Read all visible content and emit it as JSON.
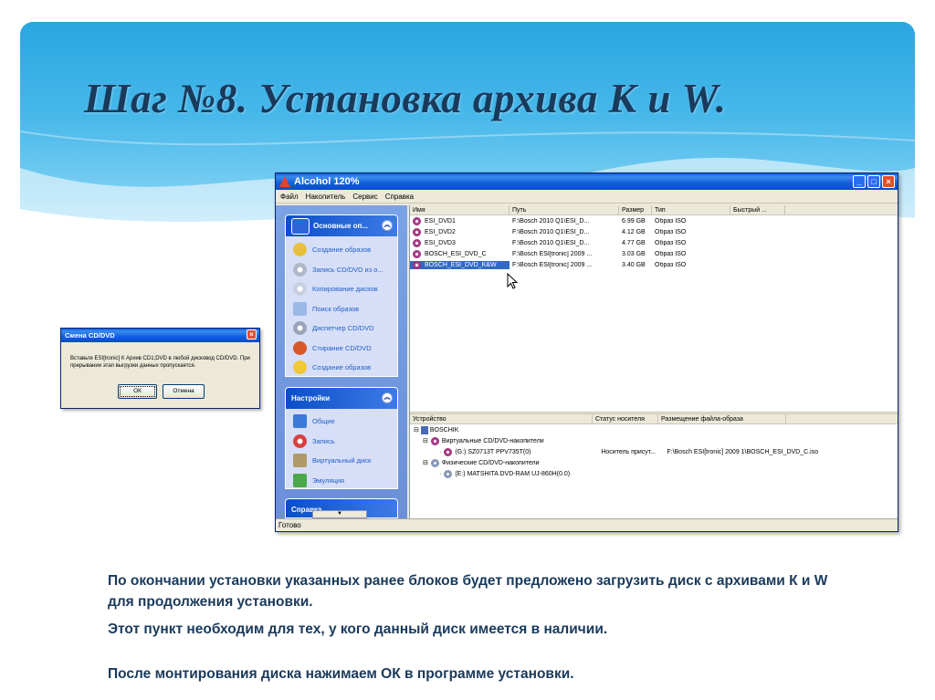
{
  "slide": {
    "title": "Шаг №8. Установка архива К и W.",
    "paragraphs": [
      "По окончании установки  указанных ранее блоков будет предложено загрузить диск с архивами К и W  для продолжения установки.",
      "Этот пункт необходим для тех, у кого данный диск имеется в наличии.",
      "После монтирования диска нажимаем ОК в программе установки."
    ]
  },
  "app": {
    "title": "Alcohol 120%",
    "menu": [
      "Файл",
      "Накопитель",
      "Сервис",
      "Справка"
    ],
    "status": "Готово",
    "panels": [
      {
        "title": "Основные оп...",
        "items": [
          "Создание образов",
          "Запись CD/DVD из о...",
          "Копирование дисков",
          "Поиск образов",
          "Диспетчер CD/DVD",
          "Стирание CD/DVD",
          "Создание образов"
        ]
      },
      {
        "title": "Настройки",
        "items": [
          "Общие",
          "Запись",
          "Виртуальный диск",
          "Эмуляция"
        ]
      },
      {
        "title": "Справка",
        "items": []
      }
    ],
    "file_columns": [
      "Имя",
      "Путь",
      "Размер",
      "Тип",
      "Быстрый ..."
    ],
    "files": [
      {
        "name": "ESI_DVD1",
        "path": "F:\\Bosch 2010 Q1\\ESI_D...",
        "size": "6.99 GB",
        "type": "Образ ISO"
      },
      {
        "name": "ESI_DVD2",
        "path": "F:\\Bosch 2010 Q1\\ESI_D...",
        "size": "4.12 GB",
        "type": "Образ ISO"
      },
      {
        "name": "ESI_DVD3",
        "path": "F:\\Bosch 2010 Q1\\ESI_D...",
        "size": "4.77 GB",
        "type": "Образ ISO"
      },
      {
        "name": "BOSCH_ESI_DVD_C",
        "path": "F:\\Bosch ESI[tronic] 2009 ...",
        "size": "3.03 GB",
        "type": "Образ ISO"
      },
      {
        "name": "BOSCH_ESI_DVD_K&W",
        "path": "F:\\Bosch ESI[tronic] 2009 ...",
        "size": "3.40 GB",
        "type": "Образ ISO"
      }
    ],
    "selected_file_index": 4,
    "device_columns": [
      "Устройство",
      "Статус носителя",
      "Размещение файла-образа"
    ],
    "devices": {
      "root": "BOSCHIK",
      "virtual_group": "Виртуальные CD/DVD-накопители",
      "virtual_drive": "(G:) SZ0713T PPV735T(0)",
      "virtual_status": "Носитель присут...",
      "virtual_location": "F:\\Bosch ESI[tronic] 2009 1\\BOSCH_ESI_DVD_C.iso",
      "physical_group": "Физические CD/DVD-накопители",
      "physical_drive": "(E:) MATSHITA DVD-RAM UJ-860H(0.0)"
    }
  },
  "dialog": {
    "title": "Смена CD/DVD",
    "message": "Вставьте ESI[tronic] К Архив CD1;DVD в любой дисковод CD/DVD. При прерывании этап выгрузки данных пропускается.",
    "ok": "ОК",
    "cancel": "Отмена"
  }
}
